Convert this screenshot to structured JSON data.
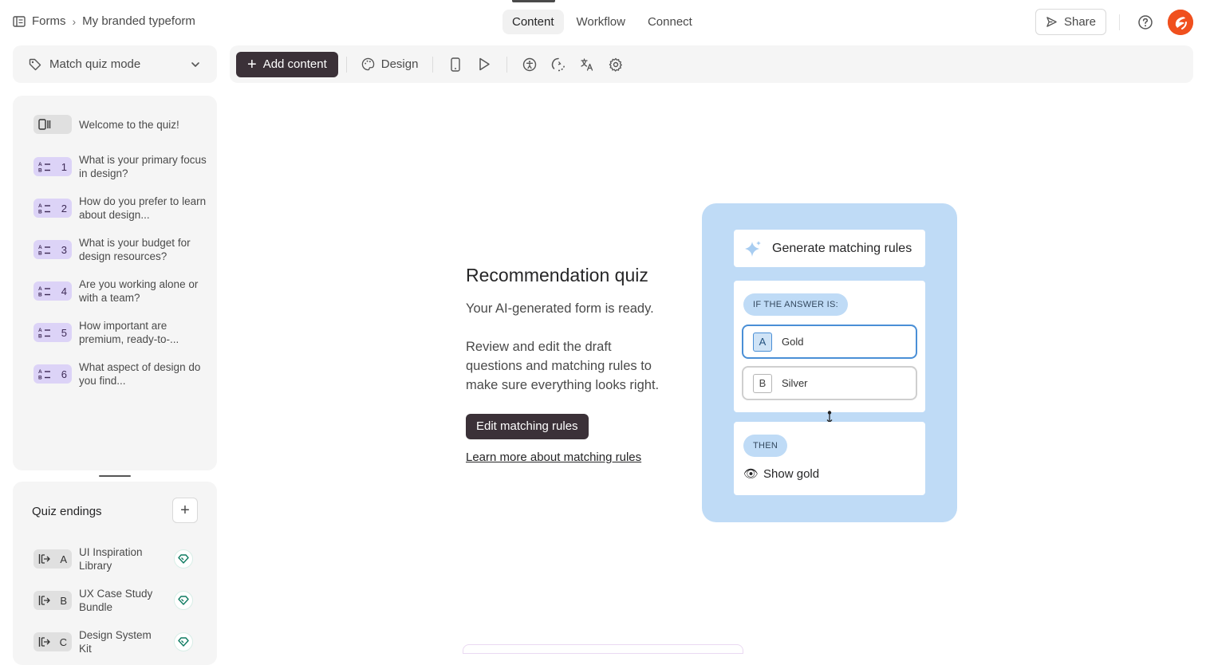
{
  "breadcrumb": {
    "root": "Forms",
    "current": "My branded typeform"
  },
  "nav": {
    "tabs": [
      {
        "label": "Content"
      },
      {
        "label": "Workflow"
      },
      {
        "label": "Connect"
      }
    ]
  },
  "header": {
    "share_label": "Share"
  },
  "mode": {
    "label": "Match quiz mode"
  },
  "toolbar": {
    "add_content_label": "Add content",
    "design_label": "Design"
  },
  "questions": [
    {
      "number": "",
      "text": "Welcome to the quiz!"
    },
    {
      "number": "1",
      "text": "What is your primary focus in design?"
    },
    {
      "number": "2",
      "text": "How do you prefer to learn about design..."
    },
    {
      "number": "3",
      "text": "What is your budget for design resources?"
    },
    {
      "number": "4",
      "text": "Are you working alone or with a team?"
    },
    {
      "number": "5",
      "text": "How important are premium, ready-to-..."
    },
    {
      "number": "6",
      "text": "What aspect of design do you find..."
    }
  ],
  "endings": {
    "title": "Quiz endings",
    "add_label": "+",
    "items": [
      {
        "key": "A",
        "text": "UI Inspiration Library"
      },
      {
        "key": "B",
        "text": "UX Case Study Bundle"
      },
      {
        "key": "C",
        "text": "Design System Kit"
      }
    ]
  },
  "main": {
    "title": "Recommendation quiz",
    "subtitle": "Your AI-generated form is ready.",
    "description": "Review and edit the draft questions and matching rules to make sure everything looks right.",
    "edit_button": "Edit matching rules",
    "learn_link": "Learn more about matching rules"
  },
  "illustration": {
    "generate_label": "Generate matching rules",
    "if_label": "IF THE ANSWER IS:",
    "options": [
      {
        "key": "A",
        "label": "Gold"
      },
      {
        "key": "B",
        "label": "Silver"
      }
    ],
    "then_label": "THEN",
    "then_result": "Show gold"
  },
  "colors": {
    "accent_dark": "#3b3138",
    "question_badge": "#dcd3f7",
    "illustration_bg": "#bfdbf6",
    "avatar": "#f0501e"
  }
}
